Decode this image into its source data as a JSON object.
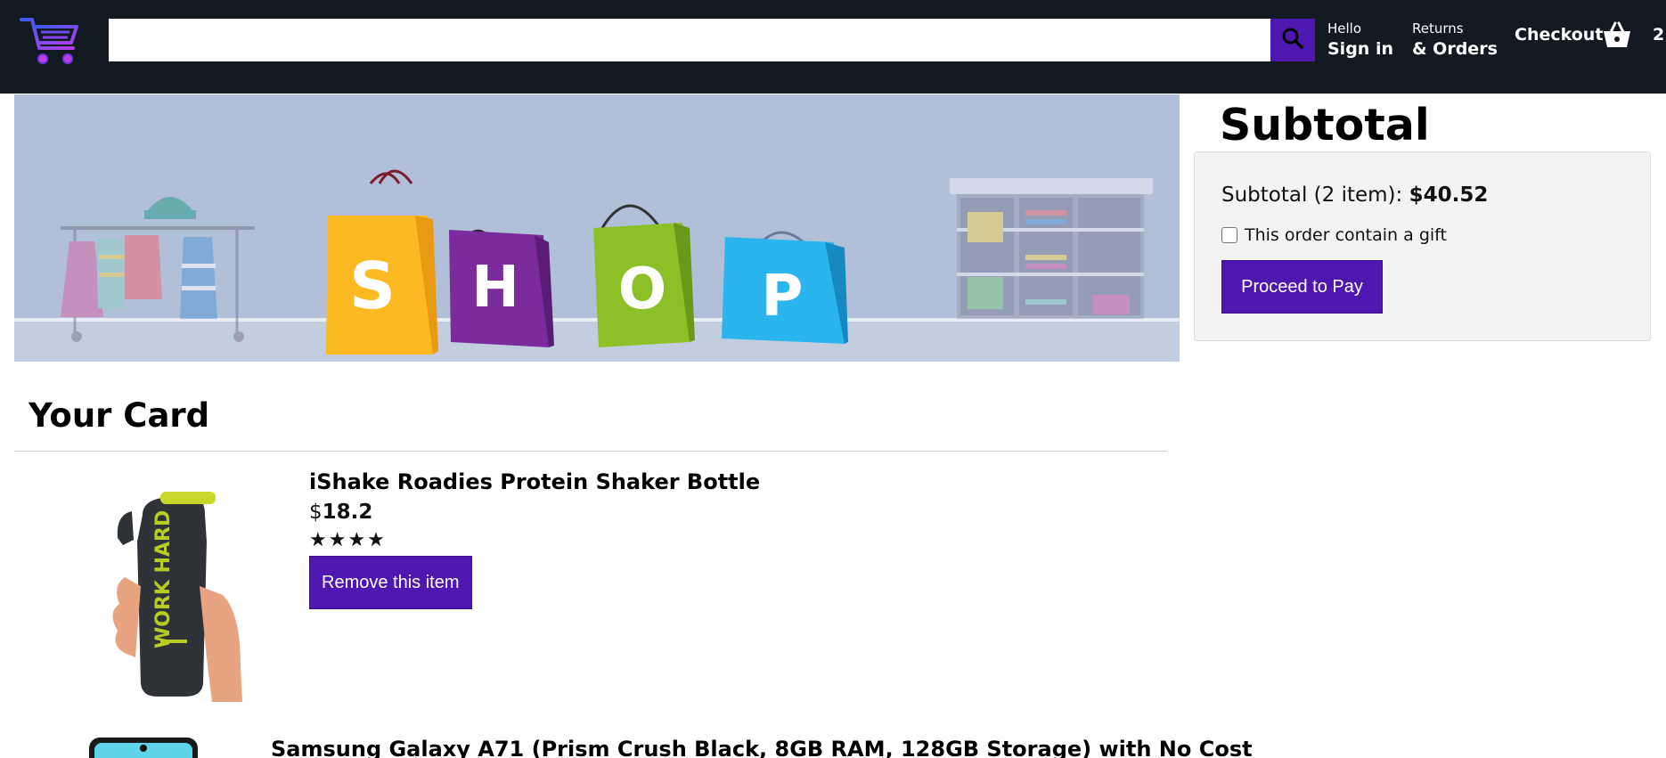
{
  "header": {
    "logo_icon": "cart-logo-icon",
    "search": {
      "value": "",
      "placeholder": "",
      "icon": "search-icon"
    },
    "signin": {
      "line1": "Hello",
      "line2": "Sign in"
    },
    "orders": {
      "line1": "Returns",
      "line2": "& Orders"
    },
    "checkout_label": "Checkout",
    "basket_icon": "basket-icon",
    "basket_count": "2"
  },
  "banner": {
    "letters": [
      "S",
      "H",
      "O",
      "P"
    ],
    "bag_colors": [
      "#fdb921",
      "#7b2b9c",
      "#8cc026",
      "#2ab5ef"
    ],
    "background": "#b1bfd8"
  },
  "cart": {
    "title": "Your Card",
    "items": [
      {
        "title": "iShake Roadies Protein Shaker Bottle",
        "currency": "$",
        "price": "18.2",
        "rating": "★★★★",
        "remove_label": "Remove this item"
      },
      {
        "title": "Samsung Galaxy A71 (Prism Crush Black, 8GB RAM, 128GB Storage) with No Cost"
      }
    ]
  },
  "subtotal": {
    "title": "Subtotal",
    "line_prefix": "Subtotal (2 item): ",
    "amount": "$40.52",
    "gift_label": "This order contain a gift",
    "gift_checked": false,
    "proceed_label": "Proceed to Pay"
  },
  "colors": {
    "header_bg": "#131921",
    "accent": "#4d17b0",
    "box_bg": "#f3f3f3"
  }
}
